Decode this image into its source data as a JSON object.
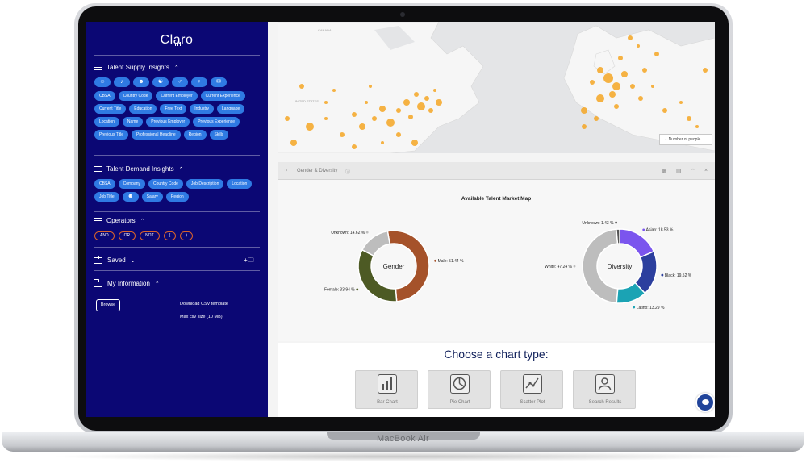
{
  "app": {
    "brand": "Claro",
    "device_label": "MacBook Air"
  },
  "sidebar": {
    "supply": {
      "title": "Talent Supply Insights",
      "icons": [
        "user-icon",
        "bell-icon",
        "users-icon",
        "group-icon",
        "gender-male-icon",
        "gender-female-icon",
        "mail-icon"
      ],
      "chips": [
        "CBSA",
        "Country Code",
        "Current Employer",
        "Current Experience",
        "Current Title",
        "Education",
        "Free Text",
        "Industry",
        "Language",
        "Location",
        "Name",
        "Previous Employer",
        "Previous Experience",
        "Previous Title",
        "Professional Headline",
        "Region",
        "Skills"
      ]
    },
    "demand": {
      "title": "Talent Demand Insights",
      "chips": [
        "CBSA",
        "Company",
        "Country Code",
        "Job Description",
        "Location",
        "Job Title",
        "",
        "Salary",
        "Region"
      ]
    },
    "operators": {
      "title": "Operators",
      "items": [
        "AND",
        "OR",
        "NOT",
        "(",
        ")"
      ]
    },
    "saved": {
      "title": "Saved"
    },
    "info": {
      "title": "My Information",
      "browse": "Browse",
      "download": "Download CSV template",
      "max": "Max csv size (10 MB)"
    }
  },
  "map": {
    "legend": "Number of people",
    "labels": [
      "CANADA",
      "UNITED STATES"
    ]
  },
  "panel": {
    "title": "Gender & Diversity"
  },
  "chart_data": [
    {
      "type": "pie",
      "title": "Available Talent Market Map",
      "center_label": "Gender",
      "slices": [
        {
          "label": "Male: 51.44 %",
          "value": 51.44,
          "color": "#a5522a"
        },
        {
          "label": "Female: 33.94 %",
          "value": 33.94,
          "color": "#4d5a24"
        },
        {
          "label": "Unknown: 14.62 %",
          "value": 14.62,
          "color": "#bdbdbd"
        }
      ]
    },
    {
      "type": "pie",
      "center_label": "Diversity",
      "slices": [
        {
          "label": "Asian: 18.53 %",
          "value": 18.53,
          "color": "#7b55ee"
        },
        {
          "label": "Black: 19.52 %",
          "value": 19.52,
          "color": "#2c3f9e"
        },
        {
          "label": "Latino: 13.29 %",
          "value": 13.29,
          "color": "#1ba3b4"
        },
        {
          "label": "White: 47.24 %",
          "value": 47.24,
          "color": "#bdbdbd"
        },
        {
          "label": "Unknown: 1.43 %",
          "value": 1.43,
          "color": "#555555"
        }
      ]
    }
  ],
  "chooser": {
    "title": "Choose a chart type:",
    "types": [
      "Bar Chart",
      "Pie Chart",
      "Scatter Plot",
      "Search Results"
    ]
  }
}
